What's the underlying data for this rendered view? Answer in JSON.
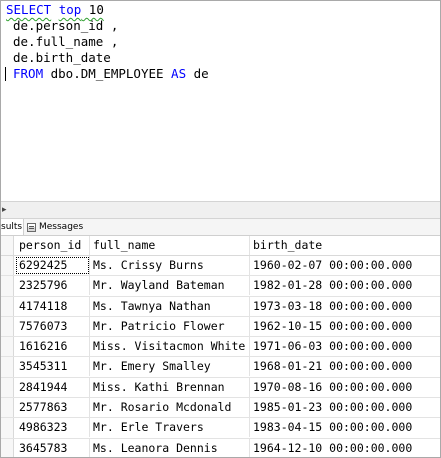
{
  "editor": {
    "lines": [
      {
        "kw1": "SELECT",
        "kw2": "top",
        "rest": " 10"
      },
      {
        "text": "de.person_id ,"
      },
      {
        "text": "de.full_name ,"
      },
      {
        "text": "de.birth_date"
      },
      {
        "kw1": "FROM",
        "mid": " dbo.DM_EMPLOYEE ",
        "kw2": "AS",
        "rest": " de"
      }
    ],
    "zoom_arrow": "▸"
  },
  "tabs": {
    "results_label": "sults",
    "messages_label": "Messages"
  },
  "grid": {
    "columns": [
      "person_id",
      "full_name",
      "birth_date"
    ],
    "rows": [
      [
        "6292425",
        "Ms. Crissy Burns",
        "1960-02-07 00:00:00.000"
      ],
      [
        "2325796",
        "Mr. Wayland Bateman",
        "1982-01-28 00:00:00.000"
      ],
      [
        "4174118",
        "Ms. Tawnya Nathan",
        "1973-03-18 00:00:00.000"
      ],
      [
        "7576073",
        "Mr. Patricio Flower",
        "1962-10-15 00:00:00.000"
      ],
      [
        "1616216",
        "Miss. Visitacmon White",
        "1971-06-03 00:00:00.000"
      ],
      [
        "3545311",
        "Mr. Emery Smalley",
        "1968-01-21 00:00:00.000"
      ],
      [
        "2841944",
        "Miss. Kathi Brennan",
        "1970-08-16 00:00:00.000"
      ],
      [
        "2577863",
        "Mr. Rosario Mcdonald",
        "1985-01-23 00:00:00.000"
      ],
      [
        "4986323",
        "Mr. Erle Travers",
        "1983-04-15 00:00:00.000"
      ],
      [
        "3645783",
        "Ms. Leanora Dennis",
        "1964-12-10 00:00:00.000"
      ]
    ]
  },
  "colors": {
    "keyword": "#0000ff",
    "squiggle": "#2e9e2e"
  }
}
